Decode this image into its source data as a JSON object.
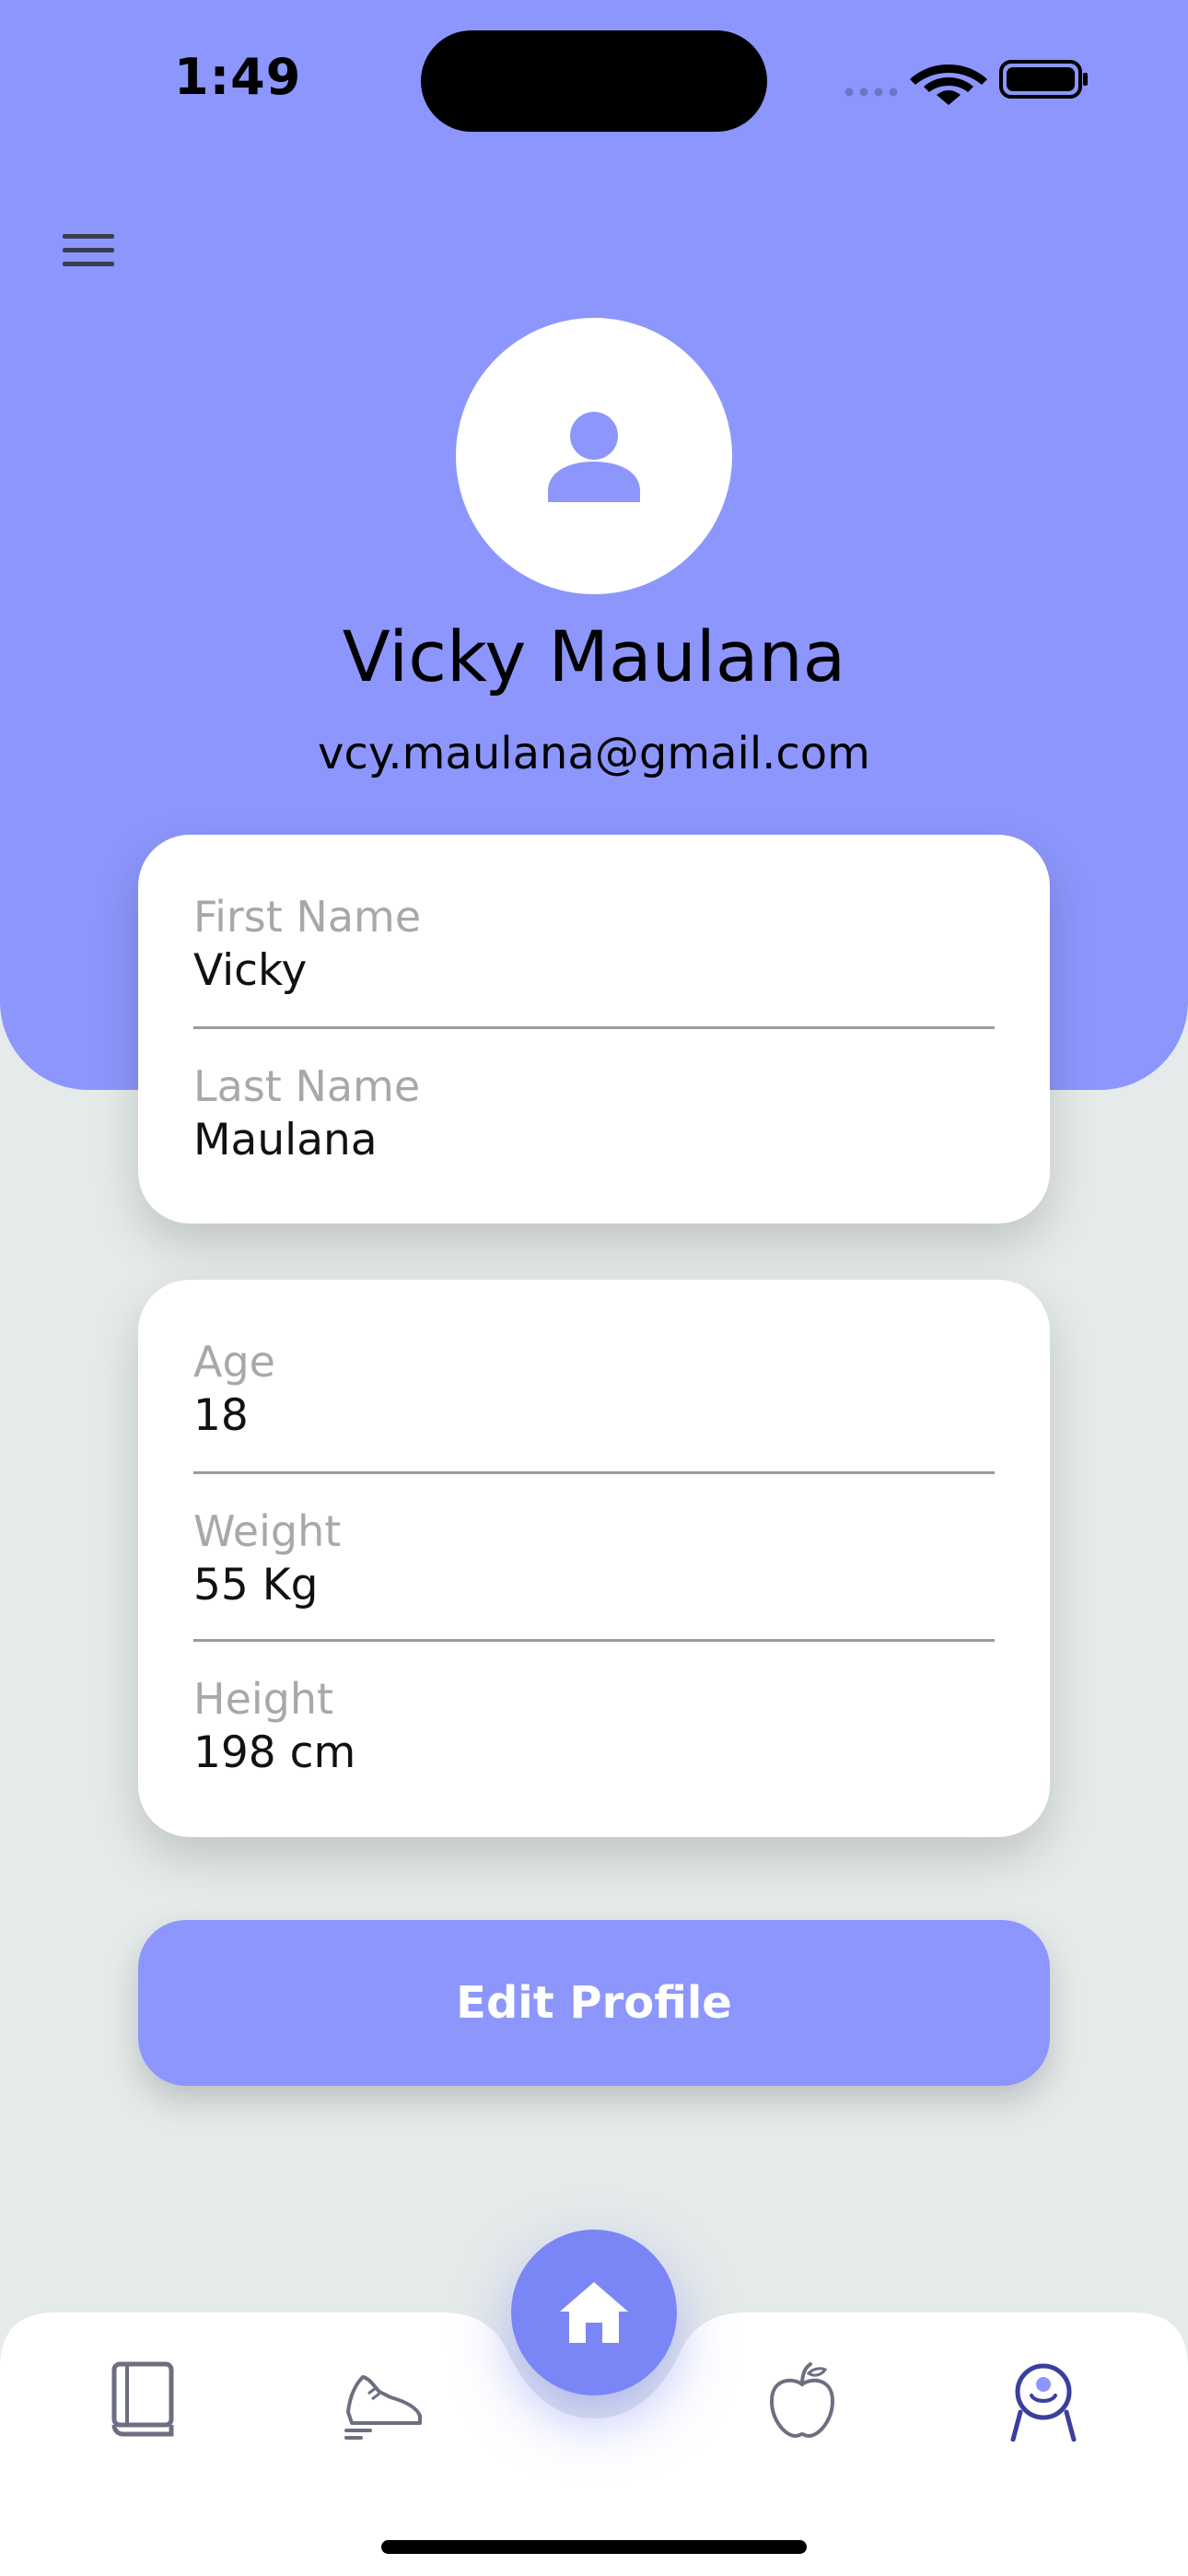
{
  "status_bar": {
    "time": "1:49"
  },
  "profile": {
    "name": "Vicky Maulana",
    "email": "vcy.maulana@gmail.com"
  },
  "name_card": {
    "fields": [
      {
        "label": "First Name",
        "value": "Vicky"
      },
      {
        "label": "Last Name",
        "value": "Maulana"
      }
    ]
  },
  "body_card": {
    "fields": [
      {
        "label": "Age",
        "value": "18"
      },
      {
        "label": "Weight",
        "value": "55 Kg"
      },
      {
        "label": "Height",
        "value": "198 cm"
      }
    ]
  },
  "edit_button_label": "Edit Profile",
  "bottom_nav": {
    "items": [
      {
        "icon": "book-icon"
      },
      {
        "icon": "sneaker-icon"
      },
      {
        "icon": "home-icon",
        "active": true
      },
      {
        "icon": "apple-icon"
      },
      {
        "icon": "profile-icon"
      }
    ]
  },
  "colors": {
    "accent": "#8c96fc",
    "background": "#e5eaea",
    "nav_icon": "#6c6f82",
    "nav_active": "#3a3f9e"
  }
}
